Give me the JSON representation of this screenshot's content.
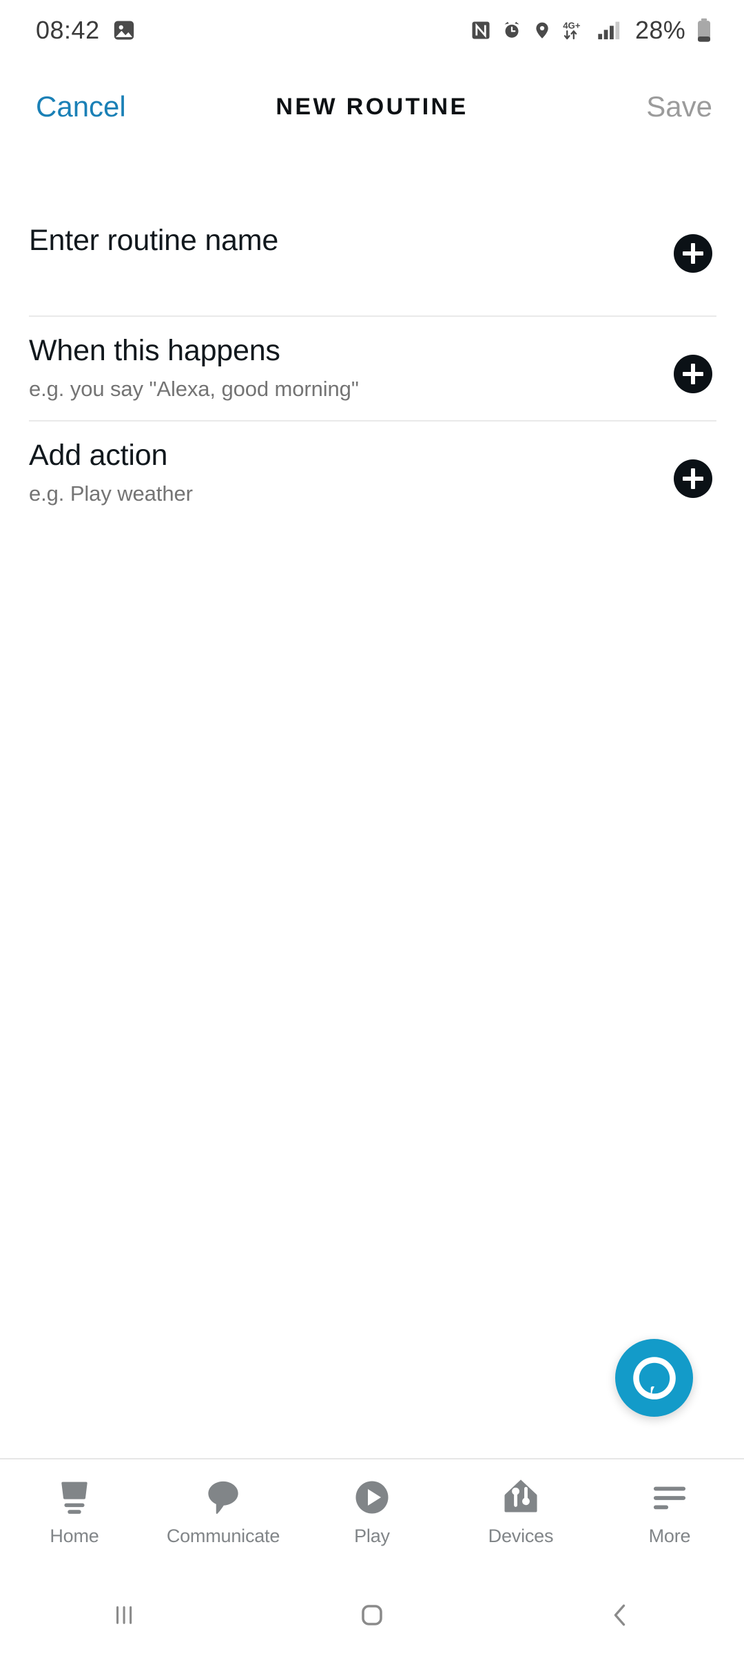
{
  "statusbar": {
    "time": "08:42",
    "battery_percent": "28%",
    "icons": [
      "image-icon",
      "nfc-icon",
      "alarm-icon",
      "location-icon",
      "network-4gplus-icon",
      "signal-bars-icon",
      "battery-icon"
    ],
    "network_label": "4G+"
  },
  "header": {
    "cancel_label": "Cancel",
    "title": "NEW ROUTINE",
    "save_label": "Save",
    "cancel_color": "#1a80b6",
    "save_color": "#9b9b9b"
  },
  "rows": [
    {
      "title": "Enter routine name",
      "subtitle": "",
      "action": "add-routine-name-button"
    },
    {
      "title": "When this happens",
      "subtitle": "e.g. you say \"Alexa, good morning\"",
      "action": "add-trigger-button"
    },
    {
      "title": "Add action",
      "subtitle": "e.g. Play weather",
      "action": "add-action-button"
    }
  ],
  "fab": {
    "name": "alexa-button",
    "color": "#139bc9"
  },
  "bottomnav": {
    "items": [
      {
        "label": "Home",
        "icon": "echo-device-icon"
      },
      {
        "label": "Communicate",
        "icon": "speech-bubble-icon"
      },
      {
        "label": "Play",
        "icon": "play-circle-icon"
      },
      {
        "label": "Devices",
        "icon": "home-devices-icon"
      },
      {
        "label": "More",
        "icon": "hamburger-menu-icon"
      }
    ],
    "icon_color": "#818588"
  },
  "androidnav": {
    "recents_label": "recent-apps",
    "home_label": "home",
    "back_label": "back"
  }
}
